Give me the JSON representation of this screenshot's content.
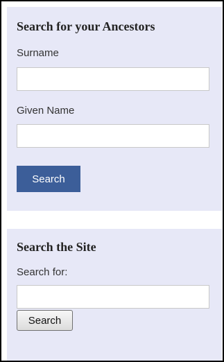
{
  "ancestor_search": {
    "title": "Search for your Ancestors",
    "surname_label": "Surname",
    "surname_value": "",
    "given_name_label": "Given Name",
    "given_name_value": "",
    "search_button_label": "Search",
    "button_color": "#3c5e99"
  },
  "site_search": {
    "title": "Search the Site",
    "search_for_label": "Search for:",
    "search_for_value": "",
    "search_button_label": "Search"
  },
  "colors": {
    "panel_background": "#e7e8f7",
    "frame_border": "#000000"
  }
}
